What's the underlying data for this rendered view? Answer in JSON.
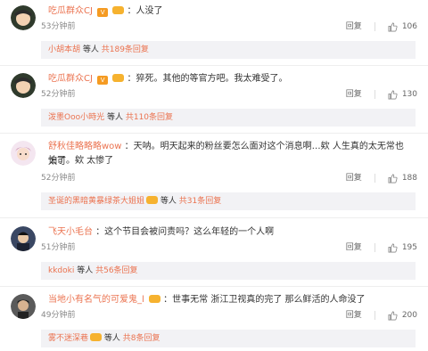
{
  "comments": [
    {
      "user": "吃瓜群众CJ",
      "text": "：人没了",
      "time": "53分钟前",
      "reply": "回复",
      "likes": "106",
      "sub": {
        "user": "小胡本胡",
        "suffix": " 等人 ",
        "count": "共189条回复"
      }
    },
    {
      "user": "吃瓜群众CJ",
      "text": "：猝死。其他的等官方吧。我太难受了。",
      "time": "52分钟前",
      "reply": "回复",
      "likes": "130",
      "sub": {
        "user": "泼墨Ooo小時光",
        "suffix": " 等人 ",
        "count": "共110条回复"
      }
    },
    {
      "user": "舒秋佳略略略wow",
      "text": "：天呐。明天起来的粉丝要怎么面对这个消息啊…欸 人生真的太无常也太可",
      "text2": "怕了。欸 太惨了",
      "time": "52分钟前",
      "reply": "回复",
      "likes": "188",
      "sub": {
        "user": "圣诞的黑暗黄暴绿茶大姐姐",
        "suffix": " 等人 ",
        "count": "共31条回复"
      }
    },
    {
      "user": "飞天小毛台",
      "text": "：这个节目会被问责吗？这么年轻的一个人啊",
      "time": "51分钟前",
      "reply": "回复",
      "likes": "195",
      "sub": {
        "user": "kkdoki",
        "suffix": " 等人 ",
        "count": "共56条回复"
      }
    },
    {
      "user": "当地小有名气的可爱鬼_l",
      "text": "：世事无常 浙江卫视真的完了 那么鲜活的人命没了",
      "time": "49分钟前",
      "reply": "回复",
      "likes": "200",
      "sub": {
        "user": "雾不迷深巷",
        "suffix": " 等人 ",
        "count": "共8条回复"
      }
    }
  ],
  "colors": {
    "username": "#eb7350",
    "subbox_bg": "#f2f2f5"
  },
  "icons": {
    "like": "thumbs-up-icon",
    "verified": "verified-v-icon",
    "member": "member-badge-icon"
  }
}
